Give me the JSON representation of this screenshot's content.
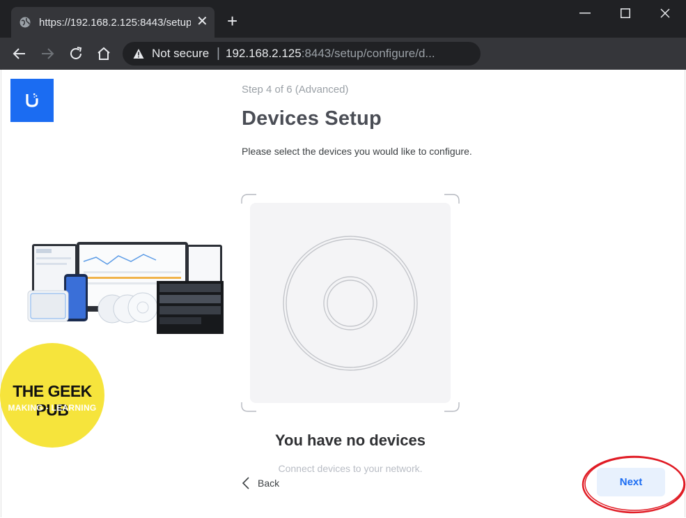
{
  "browser": {
    "tab_title": "https://192.168.2.125:8443/setup",
    "address_security": "Not secure",
    "address_host": "192.168.2.125",
    "address_path": ":8443/setup/configure/d..."
  },
  "setup": {
    "step": "Step 4 of 6 (Advanced)",
    "title": "Devices Setup",
    "subtitle": "Please select the devices you would like to configure.",
    "empty_title": "You have no devices",
    "empty_subtitle": "Connect devices to your network.",
    "back_label": "Back",
    "next_label": "Next"
  },
  "watermark": {
    "line1": "THE GEEK PUB",
    "line2": "MAKING - LEARNING"
  },
  "colors": {
    "brand_blue": "#1b6cf2",
    "annotation_red": "#e01b24",
    "watermark_yellow": "#f6e43c"
  },
  "icons": [
    "globe-icon",
    "close-icon",
    "plus-icon",
    "back-arrow-icon",
    "forward-arrow-icon",
    "reload-icon",
    "home-icon",
    "warning-icon",
    "chevron-left-icon"
  ]
}
